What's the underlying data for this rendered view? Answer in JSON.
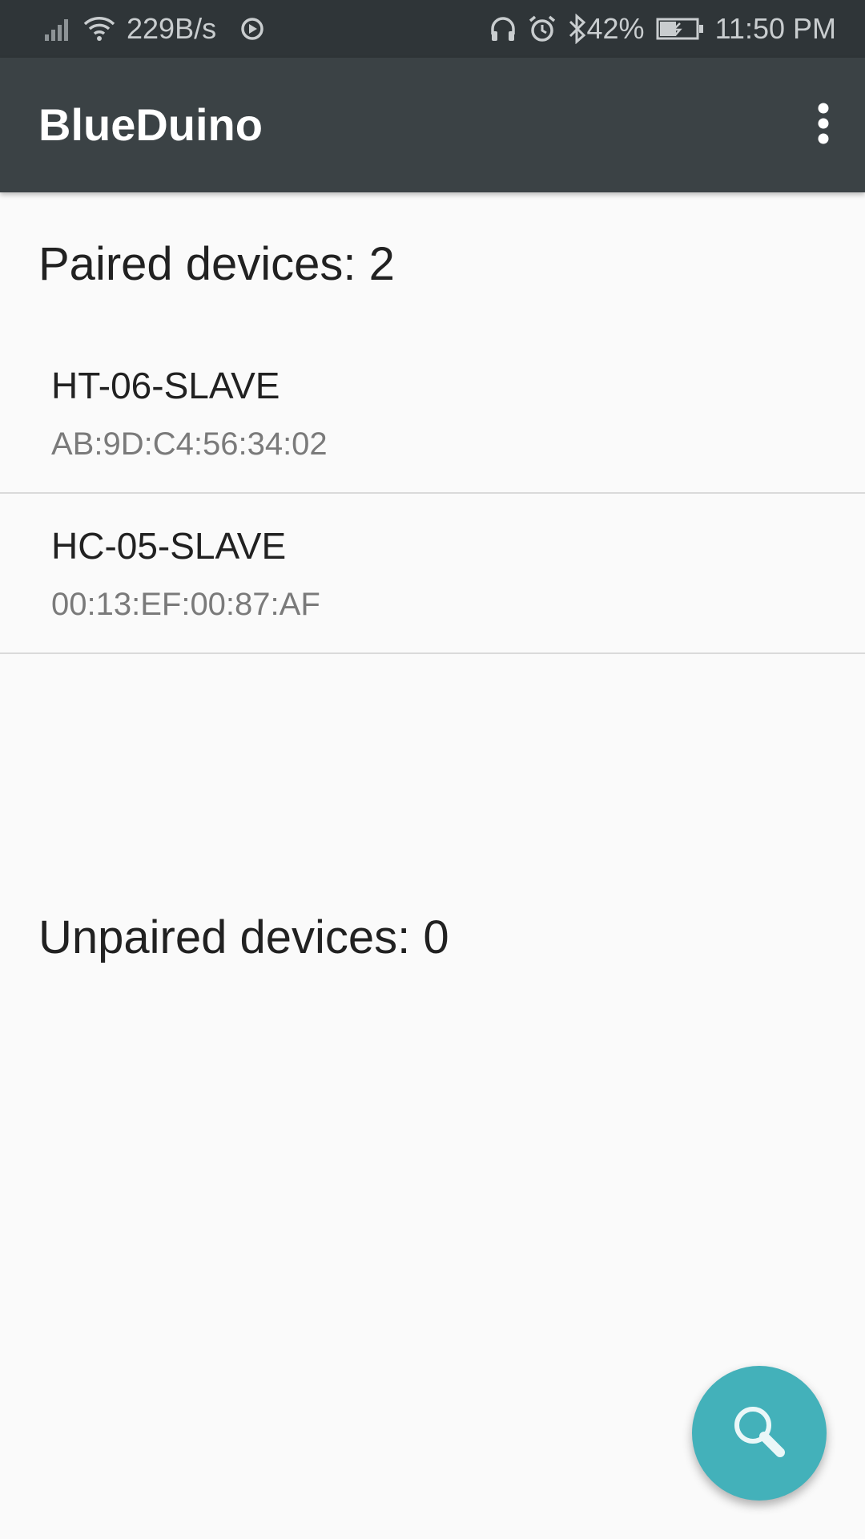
{
  "status_bar": {
    "net_speed": "229B/s",
    "battery": "42%",
    "time": "11:50 PM",
    "icons": [
      "signal-icon",
      "wifi-icon",
      "sync-icon",
      "headphones-icon",
      "alarm-icon",
      "bluetooth-icon",
      "battery-icon"
    ]
  },
  "app_bar": {
    "title": "BlueDuino",
    "menu_icon": "overflow-menu-icon"
  },
  "paired": {
    "title": "Paired devices: 2",
    "devices": [
      {
        "name": "HT-06-SLAVE",
        "address": "AB:9D:C4:56:34:02"
      },
      {
        "name": "HC-05-SLAVE",
        "address": "00:13:EF:00:87:AF"
      }
    ]
  },
  "unpaired": {
    "title": "Unpaired devices: 0"
  },
  "fab": {
    "icon": "search-icon",
    "color": "#43b1ba"
  },
  "colors": {
    "status_bar": "#2f3538",
    "app_bar": "#3b4245",
    "background": "#fafafa"
  }
}
